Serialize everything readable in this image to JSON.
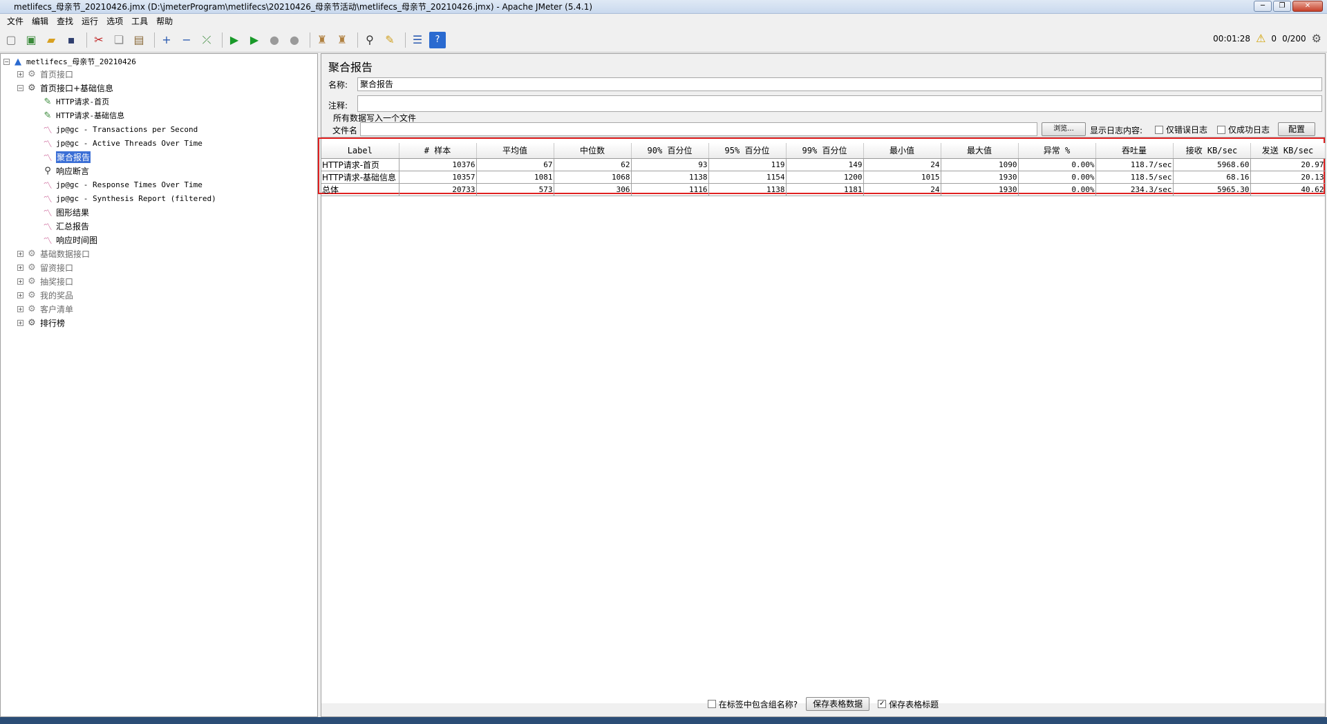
{
  "window": {
    "title": "metlifecs_母亲节_20210426.jmx (D:\\jmeterProgram\\metlifecs\\20210426_母亲节活动\\metlifecs_母亲节_20210426.jmx) - Apache JMeter (5.4.1)"
  },
  "menu": [
    "文件",
    "编辑",
    "查找",
    "运行",
    "选项",
    "工具",
    "帮助"
  ],
  "status": {
    "elapsed": "00:01:28",
    "warnings": "0",
    "threads": "0/200"
  },
  "tree": {
    "root": "metlifecs_母亲节_20210426",
    "items": [
      {
        "label": "首页接口"
      },
      {
        "label": "首页接口+基础信息"
      },
      {
        "label": "HTTP请求-首页"
      },
      {
        "label": "HTTP请求-基础信息"
      },
      {
        "label": "jp@gc - Transactions per Second"
      },
      {
        "label": "jp@gc - Active Threads Over Time"
      },
      {
        "label": "聚合报告"
      },
      {
        "label": "响应断言"
      },
      {
        "label": "jp@gc - Response Times Over Time"
      },
      {
        "label": "jp@gc - Synthesis Report (filtered)"
      },
      {
        "label": "图形结果"
      },
      {
        "label": "汇总报告"
      },
      {
        "label": "响应时间图"
      },
      {
        "label": "基础数据接口"
      },
      {
        "label": "留资接口"
      },
      {
        "label": "抽奖接口"
      },
      {
        "label": "我的奖品"
      },
      {
        "label": "客户清单"
      },
      {
        "label": "排行榜"
      }
    ]
  },
  "panel": {
    "title": "聚合报告",
    "name_label": "名称:",
    "name_value": "聚合报告",
    "comment_label": "注释:",
    "comment_value": "",
    "fileset_legend": "所有数据写入一个文件",
    "filename_label": "文件名",
    "filename_value": "",
    "browse_label": "浏览...",
    "log_label": "显示日志内容:",
    "errors_only": "仅错误日志",
    "success_only": "仅成功日志",
    "configure_label": "配置"
  },
  "table": {
    "headers": [
      "Label",
      "# 样本",
      "平均值",
      "中位数",
      "90% 百分位",
      "95% 百分位",
      "99% 百分位",
      "最小值",
      "最大值",
      "异常 %",
      "吞吐量",
      "接收 KB/sec",
      "发送 KB/sec"
    ],
    "rows": [
      [
        "HTTP请求-首页",
        "10376",
        "67",
        "62",
        "93",
        "119",
        "149",
        "24",
        "1090",
        "0.00%",
        "118.7/sec",
        "5968.60",
        "20.97"
      ],
      [
        "HTTP请求-基础信息",
        "10357",
        "1081",
        "1068",
        "1138",
        "1154",
        "1200",
        "1015",
        "1930",
        "0.00%",
        "118.5/sec",
        "68.16",
        "20.13"
      ],
      [
        "总体",
        "20733",
        "573",
        "306",
        "1116",
        "1138",
        "1181",
        "24",
        "1930",
        "0.00%",
        "234.3/sec",
        "5965.30",
        "40.62"
      ]
    ]
  },
  "bottom": {
    "include_group": "在标签中包含组名称?",
    "save_data": "保存表格数据",
    "save_header": "保存表格标题",
    "save_header_checked": true
  }
}
